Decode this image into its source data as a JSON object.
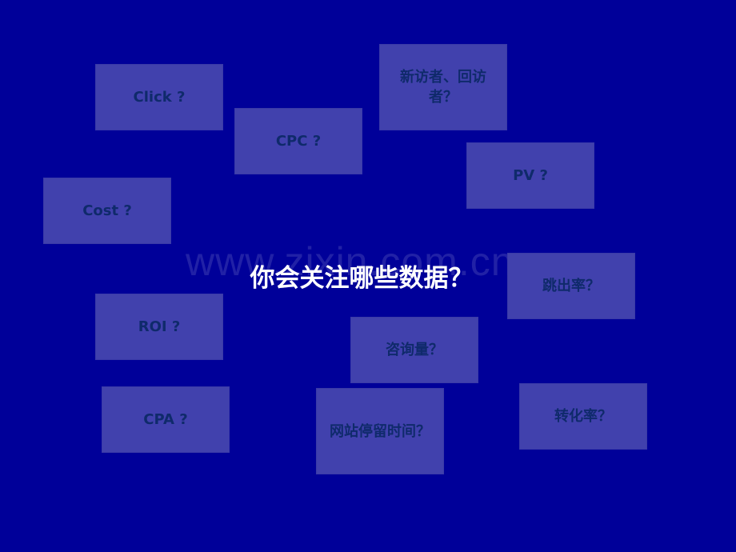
{
  "slide": {
    "title": "你会关注哪些数据？",
    "watermark": "www.zixin.com.cn",
    "colors": {
      "background": "#000099",
      "box_fill": "#4141ad",
      "box_text": "#0f2a6b",
      "title_text": "#ffffff"
    },
    "boxes": [
      {
        "id": "click",
        "label": "Click ?"
      },
      {
        "id": "cpc",
        "label": "CPC ?"
      },
      {
        "id": "visitors",
        "label": "新访者、回访者？"
      },
      {
        "id": "pv",
        "label": "PV ?"
      },
      {
        "id": "cost",
        "label": "Cost ?"
      },
      {
        "id": "bounce-rate",
        "label": "跳出率？"
      },
      {
        "id": "roi",
        "label": "ROI ?"
      },
      {
        "id": "inquiries",
        "label": "咨询量？"
      },
      {
        "id": "cpa",
        "label": "CPA ?"
      },
      {
        "id": "time-on-site",
        "label": "网站停留时间？"
      },
      {
        "id": "conversion-rate",
        "label": "转化率？"
      }
    ]
  }
}
